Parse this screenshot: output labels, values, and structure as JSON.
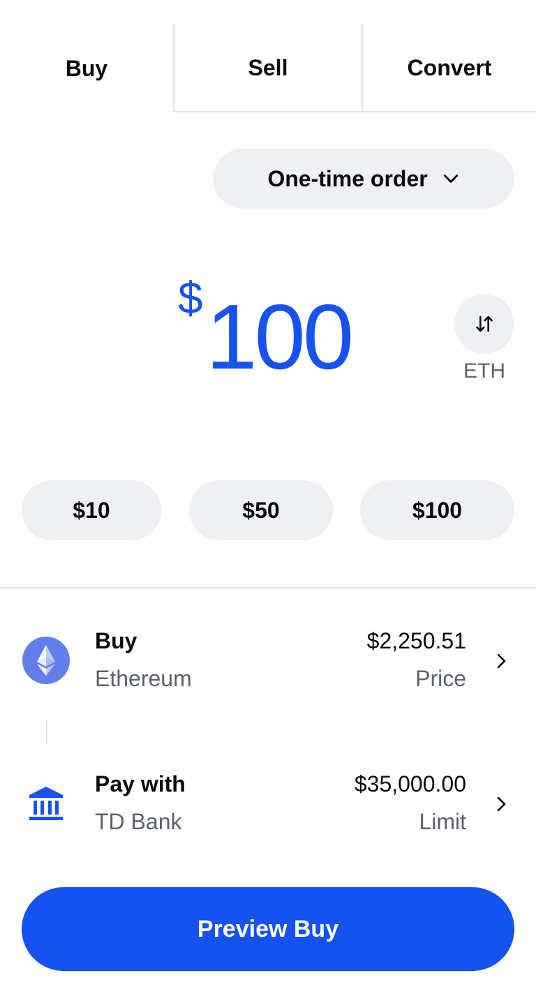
{
  "tabs": [
    {
      "label": "Buy",
      "active": true
    },
    {
      "label": "Sell",
      "active": false
    },
    {
      "label": "Convert",
      "active": false
    }
  ],
  "order_type": {
    "label": "One-time order",
    "icon": "chevron-down-icon"
  },
  "amount": {
    "currency_symbol": "$",
    "value": "100",
    "color": "#1652f0"
  },
  "toggle": {
    "icon": "swap-vertical-icon",
    "label": "ETH"
  },
  "quick_amounts": [
    "$10",
    "$50",
    "$100"
  ],
  "asset_row": {
    "icon": "ethereum-icon",
    "title": "Buy",
    "subtitle": "Ethereum",
    "amount": "$2,250.51",
    "amount_label": "Price"
  },
  "payment_row": {
    "icon": "bank-icon",
    "title": "Pay with",
    "subtitle": "TD Bank",
    "amount": "$35,000.00",
    "amount_label": "Limit"
  },
  "cta": {
    "label": "Preview Buy",
    "color": "#1652f0"
  }
}
